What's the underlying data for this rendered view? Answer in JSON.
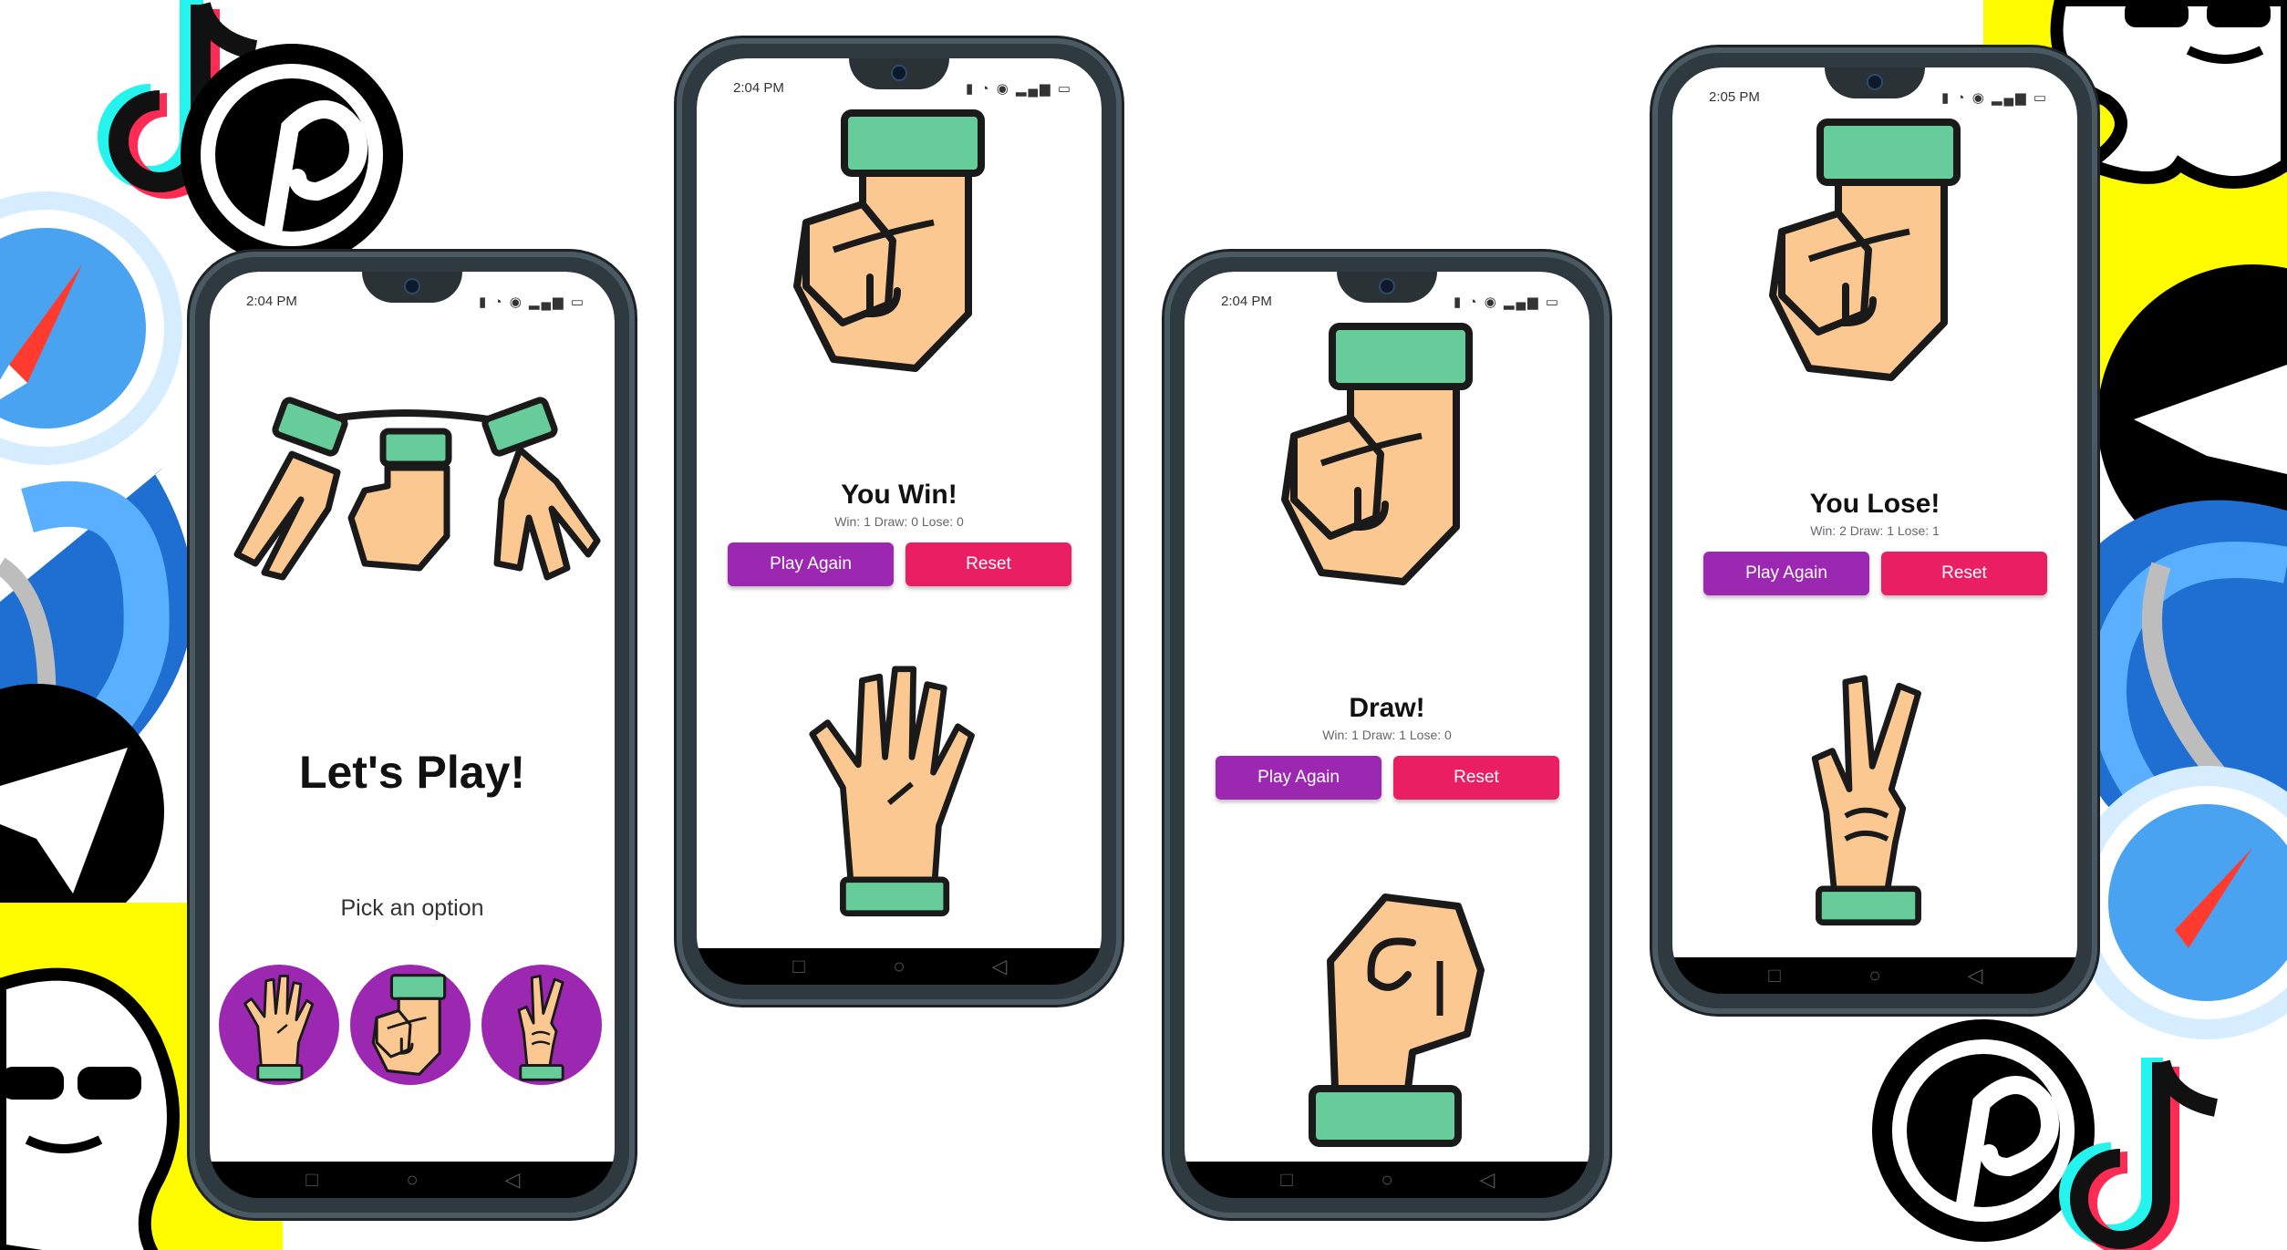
{
  "colors": {
    "play_button": "#9c27b0",
    "reset_button": "#e91e63",
    "option_circle": "#9c27b0",
    "skin": "#fbc891",
    "cuff": "#66cc99",
    "outline": "#1a1a1a"
  },
  "nav": {
    "square_icon": "square-icon",
    "circle_icon": "circle-icon",
    "back_icon": "back-triangle-icon"
  },
  "screens": [
    {
      "status_time": "2:04 PM",
      "title": "Let's Play!",
      "pick_label": "Pick an option",
      "options": [
        "paper-hand-icon",
        "rock-hand-icon",
        "scissors-hand-icon"
      ]
    },
    {
      "status_time": "2:04 PM",
      "result": "You Win!",
      "score": "Win: 1 Draw: 0 Lose: 0",
      "play_again": "Play Again",
      "reset": "Reset",
      "computer_choice": "rock",
      "player_choice": "paper"
    },
    {
      "status_time": "2:04 PM",
      "result": "Draw!",
      "score": "Win: 1 Draw: 1 Lose: 0",
      "play_again": "Play Again",
      "reset": "Reset",
      "computer_choice": "rock",
      "player_choice": "rock"
    },
    {
      "status_time": "2:05 PM",
      "result": "You Lose!",
      "score": "Win: 2 Draw: 1 Lose: 1",
      "play_again": "Play Again",
      "reset": "Reset",
      "computer_choice": "rock",
      "player_choice": "scissors"
    }
  ]
}
